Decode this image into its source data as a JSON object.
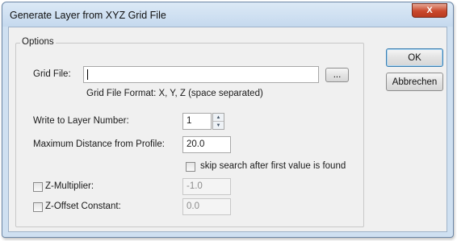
{
  "window": {
    "title": "Generate Layer from XYZ Grid File",
    "close_label": "X"
  },
  "options": {
    "group_label": "Options",
    "grid_file": {
      "label": "Grid File:",
      "value": "",
      "browse_label": "...",
      "format_hint": "Grid File Format: X, Y, Z (space separated)"
    },
    "layer_number": {
      "label": "Write to Layer Number:",
      "value": "1"
    },
    "max_distance": {
      "label": "Maximum Distance from Profile:",
      "value": "20.0"
    },
    "skip_search": {
      "label": "skip search after first value is found",
      "checked": false
    },
    "z_multiplier": {
      "label": "Z-Multiplier:",
      "value": "-1.0",
      "checked": false
    },
    "z_offset": {
      "label": "Z-Offset Constant:",
      "value": "0.0",
      "checked": false
    }
  },
  "buttons": {
    "ok_label": "OK",
    "cancel_label": "Abbrechen"
  }
}
